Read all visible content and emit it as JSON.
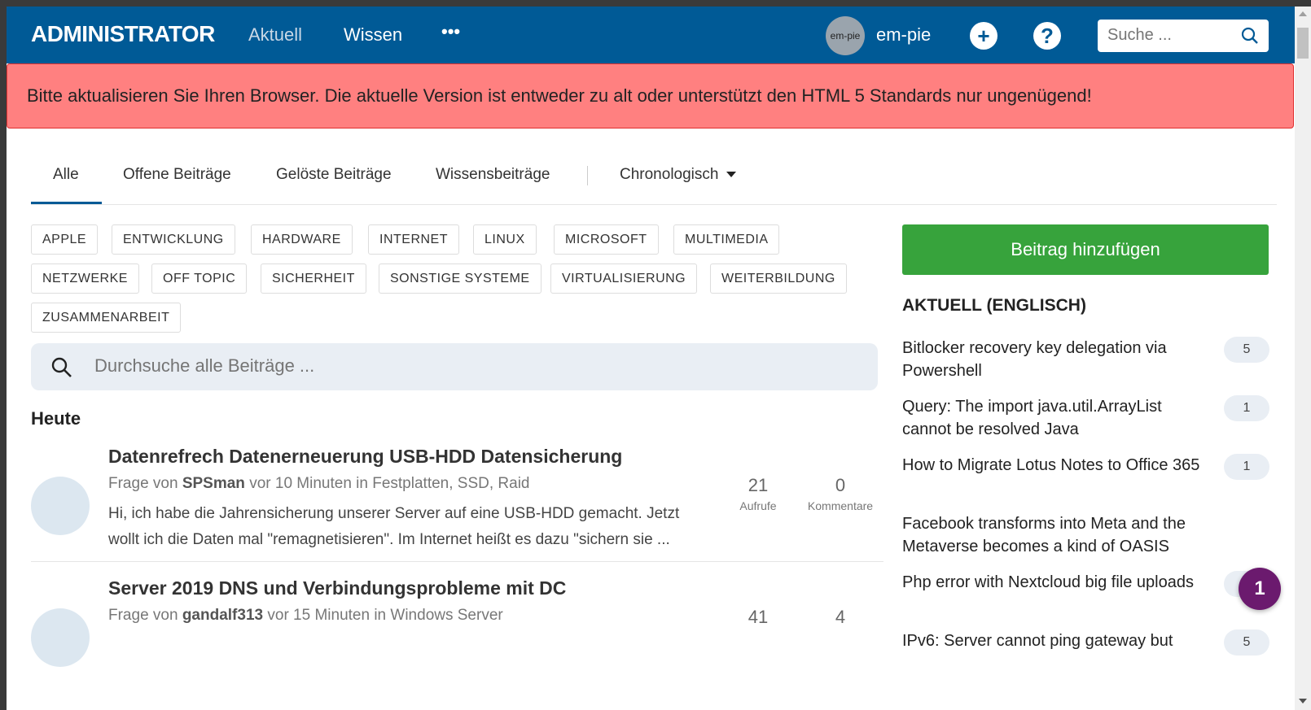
{
  "nav": {
    "logo": "ADMINISTRATOR",
    "links": [
      "Aktuell",
      "Wissen"
    ],
    "more": "•••",
    "avatar_text": "em-pie",
    "username": "em-pie",
    "add_icon": "+",
    "help_icon": "?",
    "search_placeholder": "Suche ..."
  },
  "alert": {
    "text": "Bitte aktualisieren Sie Ihren Browser. Die aktuelle Version ist entweder zu alt oder unterstützt den HTML 5 Standards nur ungenügend!"
  },
  "tabs": {
    "items": [
      "Alle",
      "Offene Beiträge",
      "Gelöste Beiträge",
      "Wissensbeiträge"
    ],
    "active": "Alle",
    "sort": "Chronologisch"
  },
  "tags": [
    "APPLE",
    "ENTWICKLUNG",
    "HARDWARE",
    "INTERNET",
    "LINUX",
    "MICROSOFT",
    "MULTIMEDIA",
    "NETZWERKE",
    "OFF TOPIC",
    "SICHERHEIT",
    "SONSTIGE SYSTEME",
    "VIRTUALISIERUNG",
    "WEITERBILDUNG",
    "ZUSAMMENARBEIT"
  ],
  "search": {
    "placeholder": "Durchsuche alle Beiträge ..."
  },
  "section": "Heute",
  "posts": [
    {
      "title": "Datenrefrech Datenerneuerung USB-HDD Datensicherung",
      "prefix": "Frage von",
      "author": "SPSman",
      "suffix": "vor 10 Minuten in Festplatten, SSD, Raid",
      "excerpt": "Hi, ich habe die Jahrensicherung unserer Server auf eine USB-HDD gemacht. Jetzt wollt ich die Daten mal \"remagnetisieren\". Im Internet heißt es dazu \"sichern sie ...",
      "views": "21",
      "views_label": "Aufrufe",
      "comments": "0",
      "comments_label": "Kommentare"
    },
    {
      "title": "Server 2019 DNS und Verbindungsprobleme mit DC",
      "prefix": "Frage von",
      "author": "gandalf313",
      "suffix": "vor 15 Minuten in Windows Server",
      "views": "41",
      "comments": "4"
    }
  ],
  "sidebar": {
    "add_button": "Beitrag hinzufügen",
    "heading": "AKTUELL (ENGLISCH)",
    "items": [
      {
        "title": "Bitlocker recovery key delegation via Powershell",
        "count": "5"
      },
      {
        "title": "Query: The import java.util.ArrayList cannot be resolved Java",
        "count": "1"
      },
      {
        "title": "How to Migrate Lotus Notes to Office 365",
        "count": "1"
      },
      {
        "title": "Facebook transforms into Meta and the Metaverse becomes a kind of OASIS",
        "count": ""
      },
      {
        "title": "Php error with Nextcloud big file uploads",
        "count": "2"
      },
      {
        "title": "IPv6: Server cannot ping gateway but",
        "count": "5"
      }
    ]
  },
  "notification_badge": "1",
  "colors": {
    "nav": "#005a96",
    "alert": "#ff8080",
    "add_button": "#37a33c",
    "badge": "#6b1a6e"
  }
}
